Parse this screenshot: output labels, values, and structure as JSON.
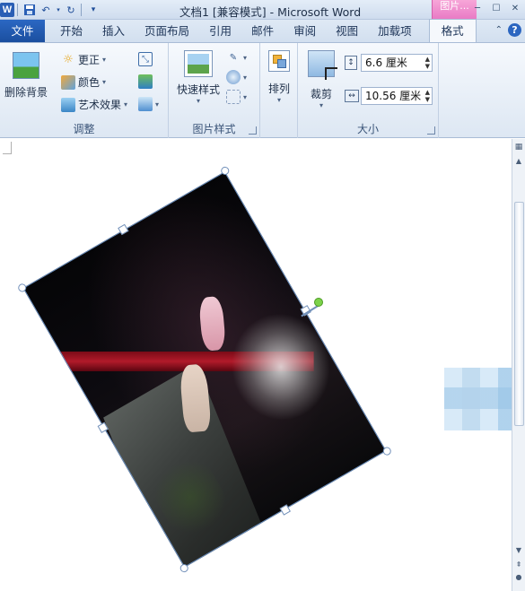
{
  "titlebar": {
    "title": "文档1 [兼容模式] - Microsoft Word",
    "context_tab": "图片...",
    "app_badge": "W"
  },
  "tabs": [
    "文件",
    "开始",
    "插入",
    "页面布局",
    "引用",
    "邮件",
    "审阅",
    "视图",
    "加载项"
  ],
  "active_tab": "格式",
  "ribbon": {
    "adjust": {
      "label": "调整",
      "remove_bg": "删除背景",
      "corrections": "更正",
      "color": "颜色",
      "artistic": "艺术效果"
    },
    "styles": {
      "label": "图片样式",
      "quick_styles": "快速样式"
    },
    "arrange": {
      "label": "排列",
      "arrange_btn": "排列"
    },
    "size": {
      "label": "大小",
      "crop": "裁剪",
      "height": "6.6 厘米",
      "width": "10.56 厘米"
    }
  },
  "colors": {
    "file_tab": "#1b4f9f",
    "context_tab": "#e879c4",
    "rotation_handle": "#7cd24a"
  }
}
